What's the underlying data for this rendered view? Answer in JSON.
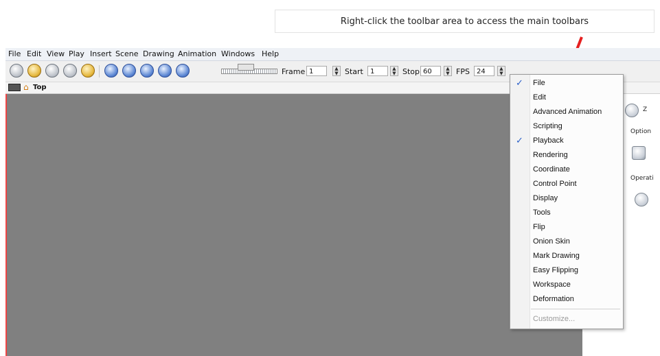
{
  "callout": {
    "text": "Right-click the toolbar area to access the main toolbars"
  },
  "menubar": {
    "items": [
      "File",
      "Edit",
      "View",
      "Play",
      "Insert",
      "Scene",
      "Drawing",
      "Animation",
      "Windows",
      "Help"
    ]
  },
  "toolbar": {
    "frame_label": "Frame",
    "frame_value": "1",
    "start_label": "Start",
    "start_value": "1",
    "stop_label": "Stop",
    "stop_value": "60",
    "fps_label": "FPS",
    "fps_value": "24"
  },
  "view": {
    "title": "Top"
  },
  "right_panel": {
    "zoom_label": "Z",
    "options_label": "Option",
    "operations_label": "Operati"
  },
  "context_menu": {
    "items": [
      {
        "label": "File",
        "checked": true
      },
      {
        "label": "Edit",
        "checked": false
      },
      {
        "label": "Advanced Animation",
        "checked": false
      },
      {
        "label": "Scripting",
        "checked": false
      },
      {
        "label": "Playback",
        "checked": true
      },
      {
        "label": "Rendering",
        "checked": false
      },
      {
        "label": "Coordinate",
        "checked": false
      },
      {
        "label": "Control Point",
        "checked": false
      },
      {
        "label": "Display",
        "checked": false
      },
      {
        "label": "Tools",
        "checked": false
      },
      {
        "label": "Flip",
        "checked": false
      },
      {
        "label": "Onion Skin",
        "checked": false
      },
      {
        "label": "Mark Drawing",
        "checked": false
      },
      {
        "label": "Easy Flipping",
        "checked": false
      },
      {
        "label": "Workspace",
        "checked": false
      },
      {
        "label": "Deformation",
        "checked": false
      }
    ],
    "customize": "Customize..."
  },
  "colors": {
    "viewport": "#808080",
    "checkmark": "#2a5fc8",
    "arrow": "#e62020"
  }
}
